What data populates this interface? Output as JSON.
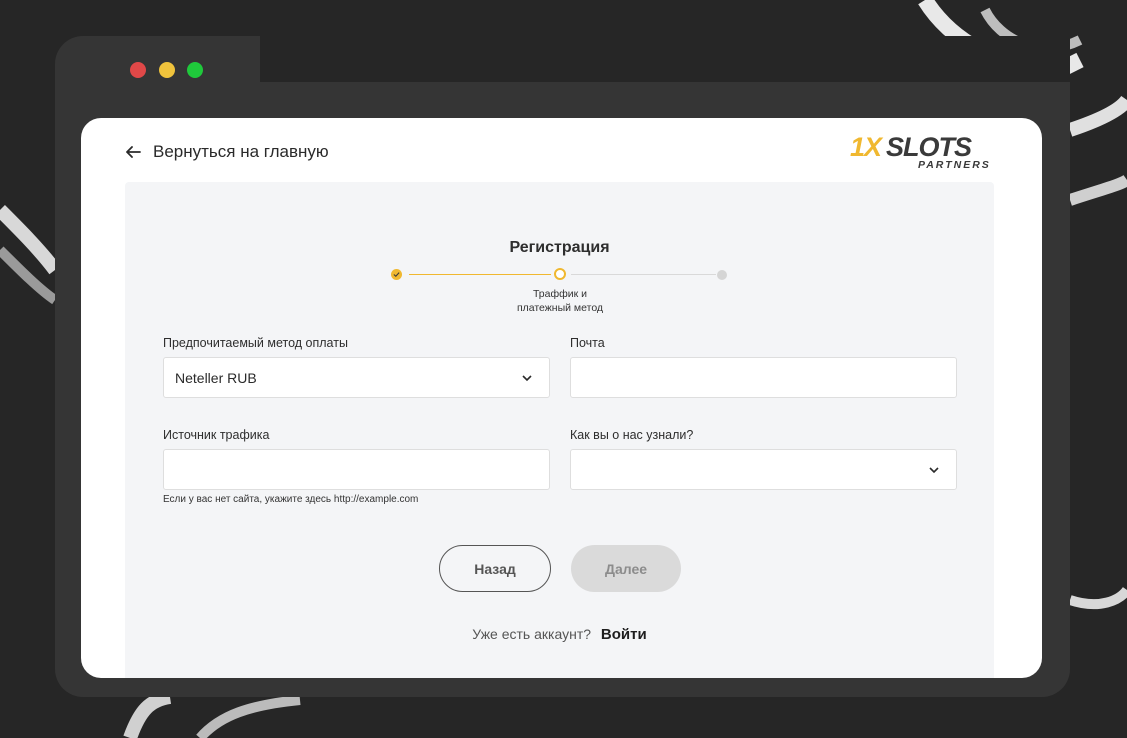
{
  "window": {
    "controls": [
      "close",
      "minimize",
      "maximize"
    ]
  },
  "header": {
    "back_label": "Вернуться на главную",
    "logo_text_main": "1XSLOTS",
    "logo_text_sub": "PARTNERS"
  },
  "form": {
    "title": "Регистрация",
    "stepper": {
      "current_step_label": "Траффик и платежный метод",
      "steps": [
        "done",
        "active",
        "todo"
      ]
    },
    "payment_method": {
      "label": "Предпочитаемый метод оплаты",
      "value": "Neteller RUB"
    },
    "email": {
      "label": "Почта",
      "value": ""
    },
    "traffic_source": {
      "label": "Источник трафика",
      "value": "",
      "hint": "Если у вас нет сайта, укажите здесь http://example.com"
    },
    "referral": {
      "label": "Как вы о нас узнали?",
      "value": ""
    },
    "back_button": "Назад",
    "next_button": "Далее",
    "login_prompt": "Уже есть аккаунт?",
    "login_link": "Войти"
  },
  "colors": {
    "accent": "#f0b830",
    "page_bg": "#262626",
    "frame": "#353535",
    "panel": "#f4f5f7"
  }
}
